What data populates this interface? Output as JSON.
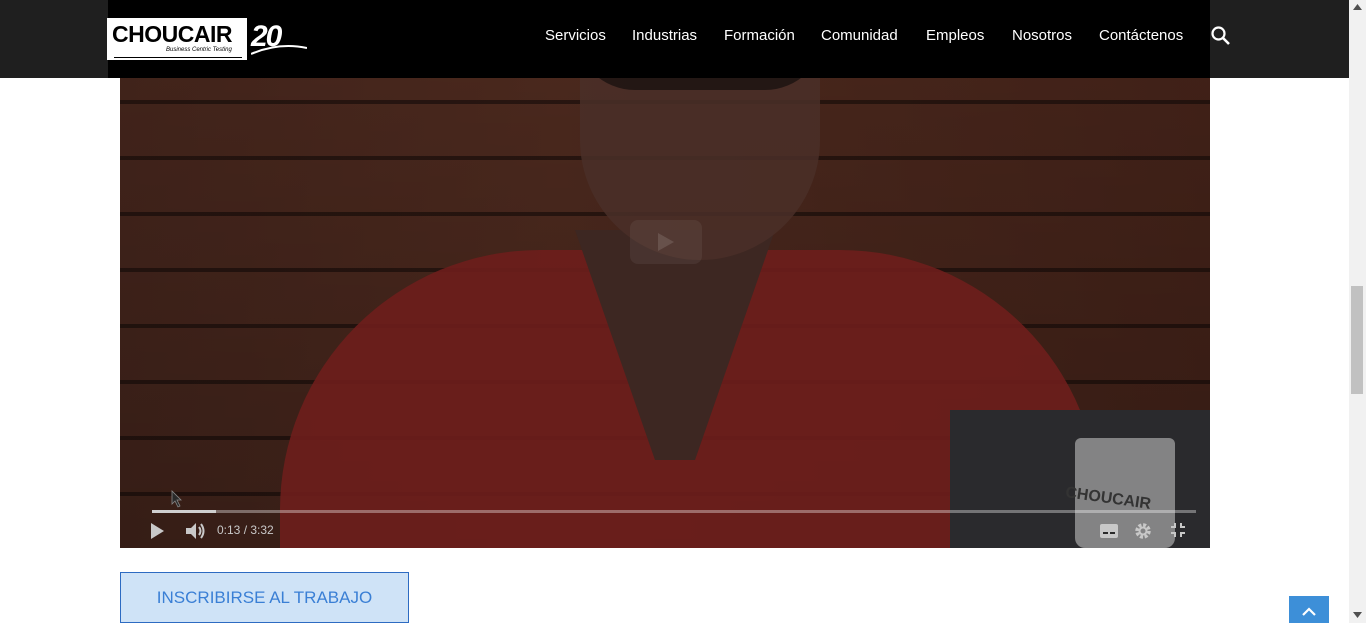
{
  "header": {
    "logo_text": "CHOUCAIR",
    "logo_tagline": "Business Centric Testing",
    "logo_years": "20",
    "nav": [
      {
        "label": "Servicios"
      },
      {
        "label": "Industrias"
      },
      {
        "label": "Formación"
      },
      {
        "label": "Comunidad"
      },
      {
        "label": "Empleos"
      },
      {
        "label": "Nosotros"
      },
      {
        "label": "Contáctenos"
      }
    ],
    "search_icon": "search-icon"
  },
  "video": {
    "time_display": "0:13 / 3:32",
    "progress_fraction": 0.061,
    "mug_text": "CHOUCAIR",
    "icons": [
      "play-icon",
      "volume-icon",
      "captions-icon",
      "settings-icon",
      "exit-fullscreen-icon"
    ]
  },
  "main": {
    "apply_button": "INSCRIBIRSE AL TRABAJO"
  },
  "colors": {
    "nav_bg": "#000000",
    "button_bg": "#cfe3f7",
    "button_text": "#3a7fd5",
    "back_to_top": "#3d8fd8"
  }
}
